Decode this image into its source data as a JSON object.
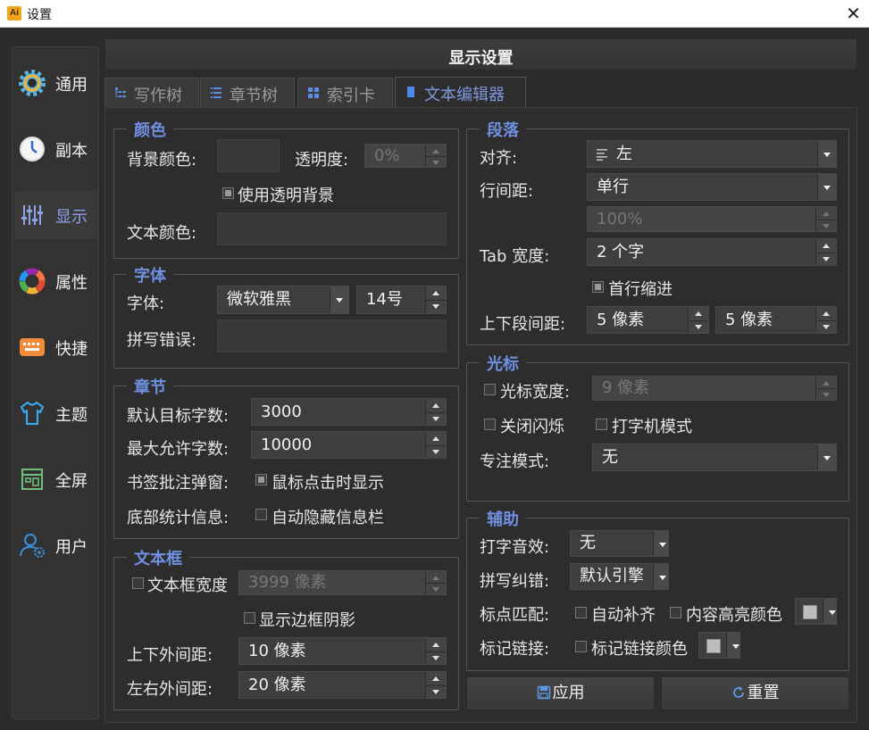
{
  "window": {
    "title": "设置",
    "app_icon_text": "Ai",
    "close_glyph": "✕"
  },
  "sidebar": {
    "items": [
      {
        "label": "通用",
        "icon": "gear-icon"
      },
      {
        "label": "副本",
        "icon": "clock-icon"
      },
      {
        "label": "显示",
        "icon": "sliders-icon",
        "active": true
      },
      {
        "label": "属性",
        "icon": "color-wheel-icon"
      },
      {
        "label": "快捷",
        "icon": "keyboard-icon"
      },
      {
        "label": "主题",
        "icon": "tshirt-icon"
      },
      {
        "label": "全屏",
        "icon": "fullscreen-icon"
      },
      {
        "label": "用户",
        "icon": "user-settings-icon"
      }
    ]
  },
  "header": {
    "title": "显示设置"
  },
  "tabs": [
    {
      "label": "写作树",
      "icon": "tree-icon"
    },
    {
      "label": "章节树",
      "icon": "list-icon"
    },
    {
      "label": "索引卡",
      "icon": "grid-icon"
    },
    {
      "label": "文本编辑器",
      "icon": "document-icon",
      "active": true
    }
  ],
  "color_group": {
    "title": "颜色",
    "bg_color_label": "背景颜色:",
    "opacity_label": "透明度:",
    "opacity_value": "0%",
    "use_transparent_bg": "使用透明背景",
    "text_color_label": "文本颜色:"
  },
  "font_group": {
    "title": "字体",
    "font_label": "字体:",
    "font_value": "微软雅黑",
    "size_value": "14号",
    "spell_error_label": "拼写错误:"
  },
  "chapter_group": {
    "title": "章节",
    "default_target_label": "默认目标字数:",
    "default_target_value": "3000",
    "max_allowed_label": "最大允许字数:",
    "max_allowed_value": "10000",
    "bookmark_label": "书签批注弹窗:",
    "bookmark_option": "鼠标点击时显示",
    "stats_label": "底部统计信息:",
    "stats_option": "自动隐藏信息栏"
  },
  "textbox_group": {
    "title": "文本框",
    "width_label": "文本框宽度",
    "width_value": "3999 像素",
    "shadow_label": "显示边框阴影",
    "vmargin_label": "上下外间距:",
    "vmargin_value": "10 像素",
    "hmargin_label": "左右外间距:",
    "hmargin_value": "20 像素"
  },
  "paragraph_group": {
    "title": "段落",
    "align_label": "对齐:",
    "align_value": "左",
    "line_spacing_label": "行间距:",
    "line_spacing_value": "单行",
    "line_spacing_percent": "100%",
    "tab_width_label": "Tab 宽度:",
    "tab_width_value": "2 个字",
    "first_indent_label": "首行缩进",
    "para_spacing_label": "上下段间距:",
    "para_spacing_top": "5 像素",
    "para_spacing_bottom": "5 像素"
  },
  "cursor_group": {
    "title": "光标",
    "cursor_width_label": "光标宽度:",
    "cursor_width_value": "9 像素",
    "no_blink_label": "关闭闪烁",
    "typewriter_label": "打字机模式",
    "focus_label": "专注模式:",
    "focus_value": "无"
  },
  "assist_group": {
    "title": "辅助",
    "typing_sound_label": "打字音效:",
    "typing_sound_value": "无",
    "spellcheck_label": "拼写纠错:",
    "spellcheck_value": "默认引擎",
    "punct_label": "标点匹配:",
    "auto_complete_label": "自动补齐",
    "highlight_label": "内容高亮颜色",
    "mark_link_label": "标记链接:",
    "mark_link_color_label": "标记链接颜色"
  },
  "actions": {
    "apply": "应用",
    "reset": "重置"
  },
  "colors": {
    "accent": "#6f8fe0",
    "background": "#2b2b2b",
    "active_text": "#8ea2e8"
  }
}
